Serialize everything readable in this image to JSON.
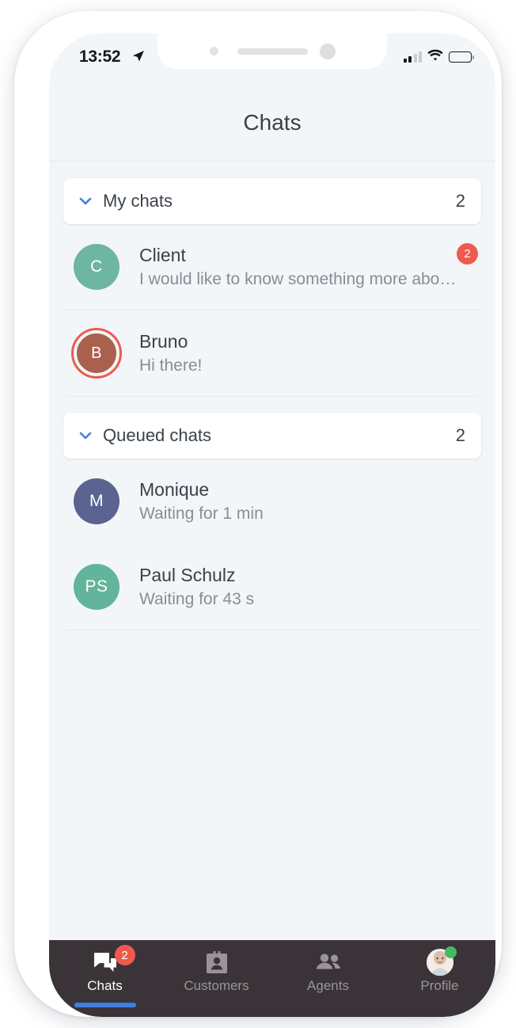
{
  "status_bar": {
    "time": "13:52",
    "location_icon": "location-arrow-icon",
    "signal_icon": "cellular-signal-icon",
    "signal_bars_filled": 2,
    "signal_bars_total": 4,
    "wifi_icon": "wifi-icon",
    "battery_icon": "battery-full-icon"
  },
  "header": {
    "title": "Chats"
  },
  "sections": [
    {
      "id": "my-chats",
      "label": "My chats",
      "count": "2",
      "chevron_icon": "chevron-down-icon",
      "rows": [
        {
          "name": "Client",
          "preview": "I would like to know something more abo…",
          "initials": "C",
          "avatar_color": "#6fb5a3",
          "ringed": false,
          "badge": "2"
        },
        {
          "name": "Bruno",
          "preview": "Hi there!",
          "initials": "B",
          "avatar_color": "#a9604c",
          "ring_color": "#ef5a4c",
          "ringed": true,
          "badge": ""
        }
      ]
    },
    {
      "id": "queued-chats",
      "label": "Queued chats",
      "count": "2",
      "chevron_icon": "chevron-down-icon",
      "rows": [
        {
          "name": "Monique",
          "preview": "Waiting for 1 min",
          "initials": "M",
          "avatar_color": "#5b6490",
          "ringed": false,
          "badge": ""
        },
        {
          "name": "Paul Schulz",
          "preview": "Waiting for 43 s",
          "initials": "PS",
          "avatar_color": "#62b49b",
          "ringed": false,
          "badge": ""
        }
      ]
    }
  ],
  "tabbar": {
    "background": "#3a3438",
    "active_color": "#3e7fe0",
    "tabs": [
      {
        "id": "chats",
        "label": "Chats",
        "icon": "chat-bubbles-icon",
        "active": true,
        "badge": "2"
      },
      {
        "id": "customers",
        "label": "Customers",
        "icon": "contact-card-icon",
        "active": false,
        "badge": ""
      },
      {
        "id": "agents",
        "label": "Agents",
        "icon": "people-icon",
        "active": false,
        "badge": ""
      },
      {
        "id": "profile",
        "label": "Profile",
        "icon": "profile-avatar-icon",
        "active": false,
        "badge": "",
        "online": true
      }
    ]
  },
  "colors": {
    "screen_background": "#f2f6f9",
    "accent_blue": "#3e7fe0",
    "badge_red": "#ef5a4c",
    "online_green": "#45bb62",
    "text_primary": "#3a4149",
    "text_secondary": "#868e96"
  }
}
